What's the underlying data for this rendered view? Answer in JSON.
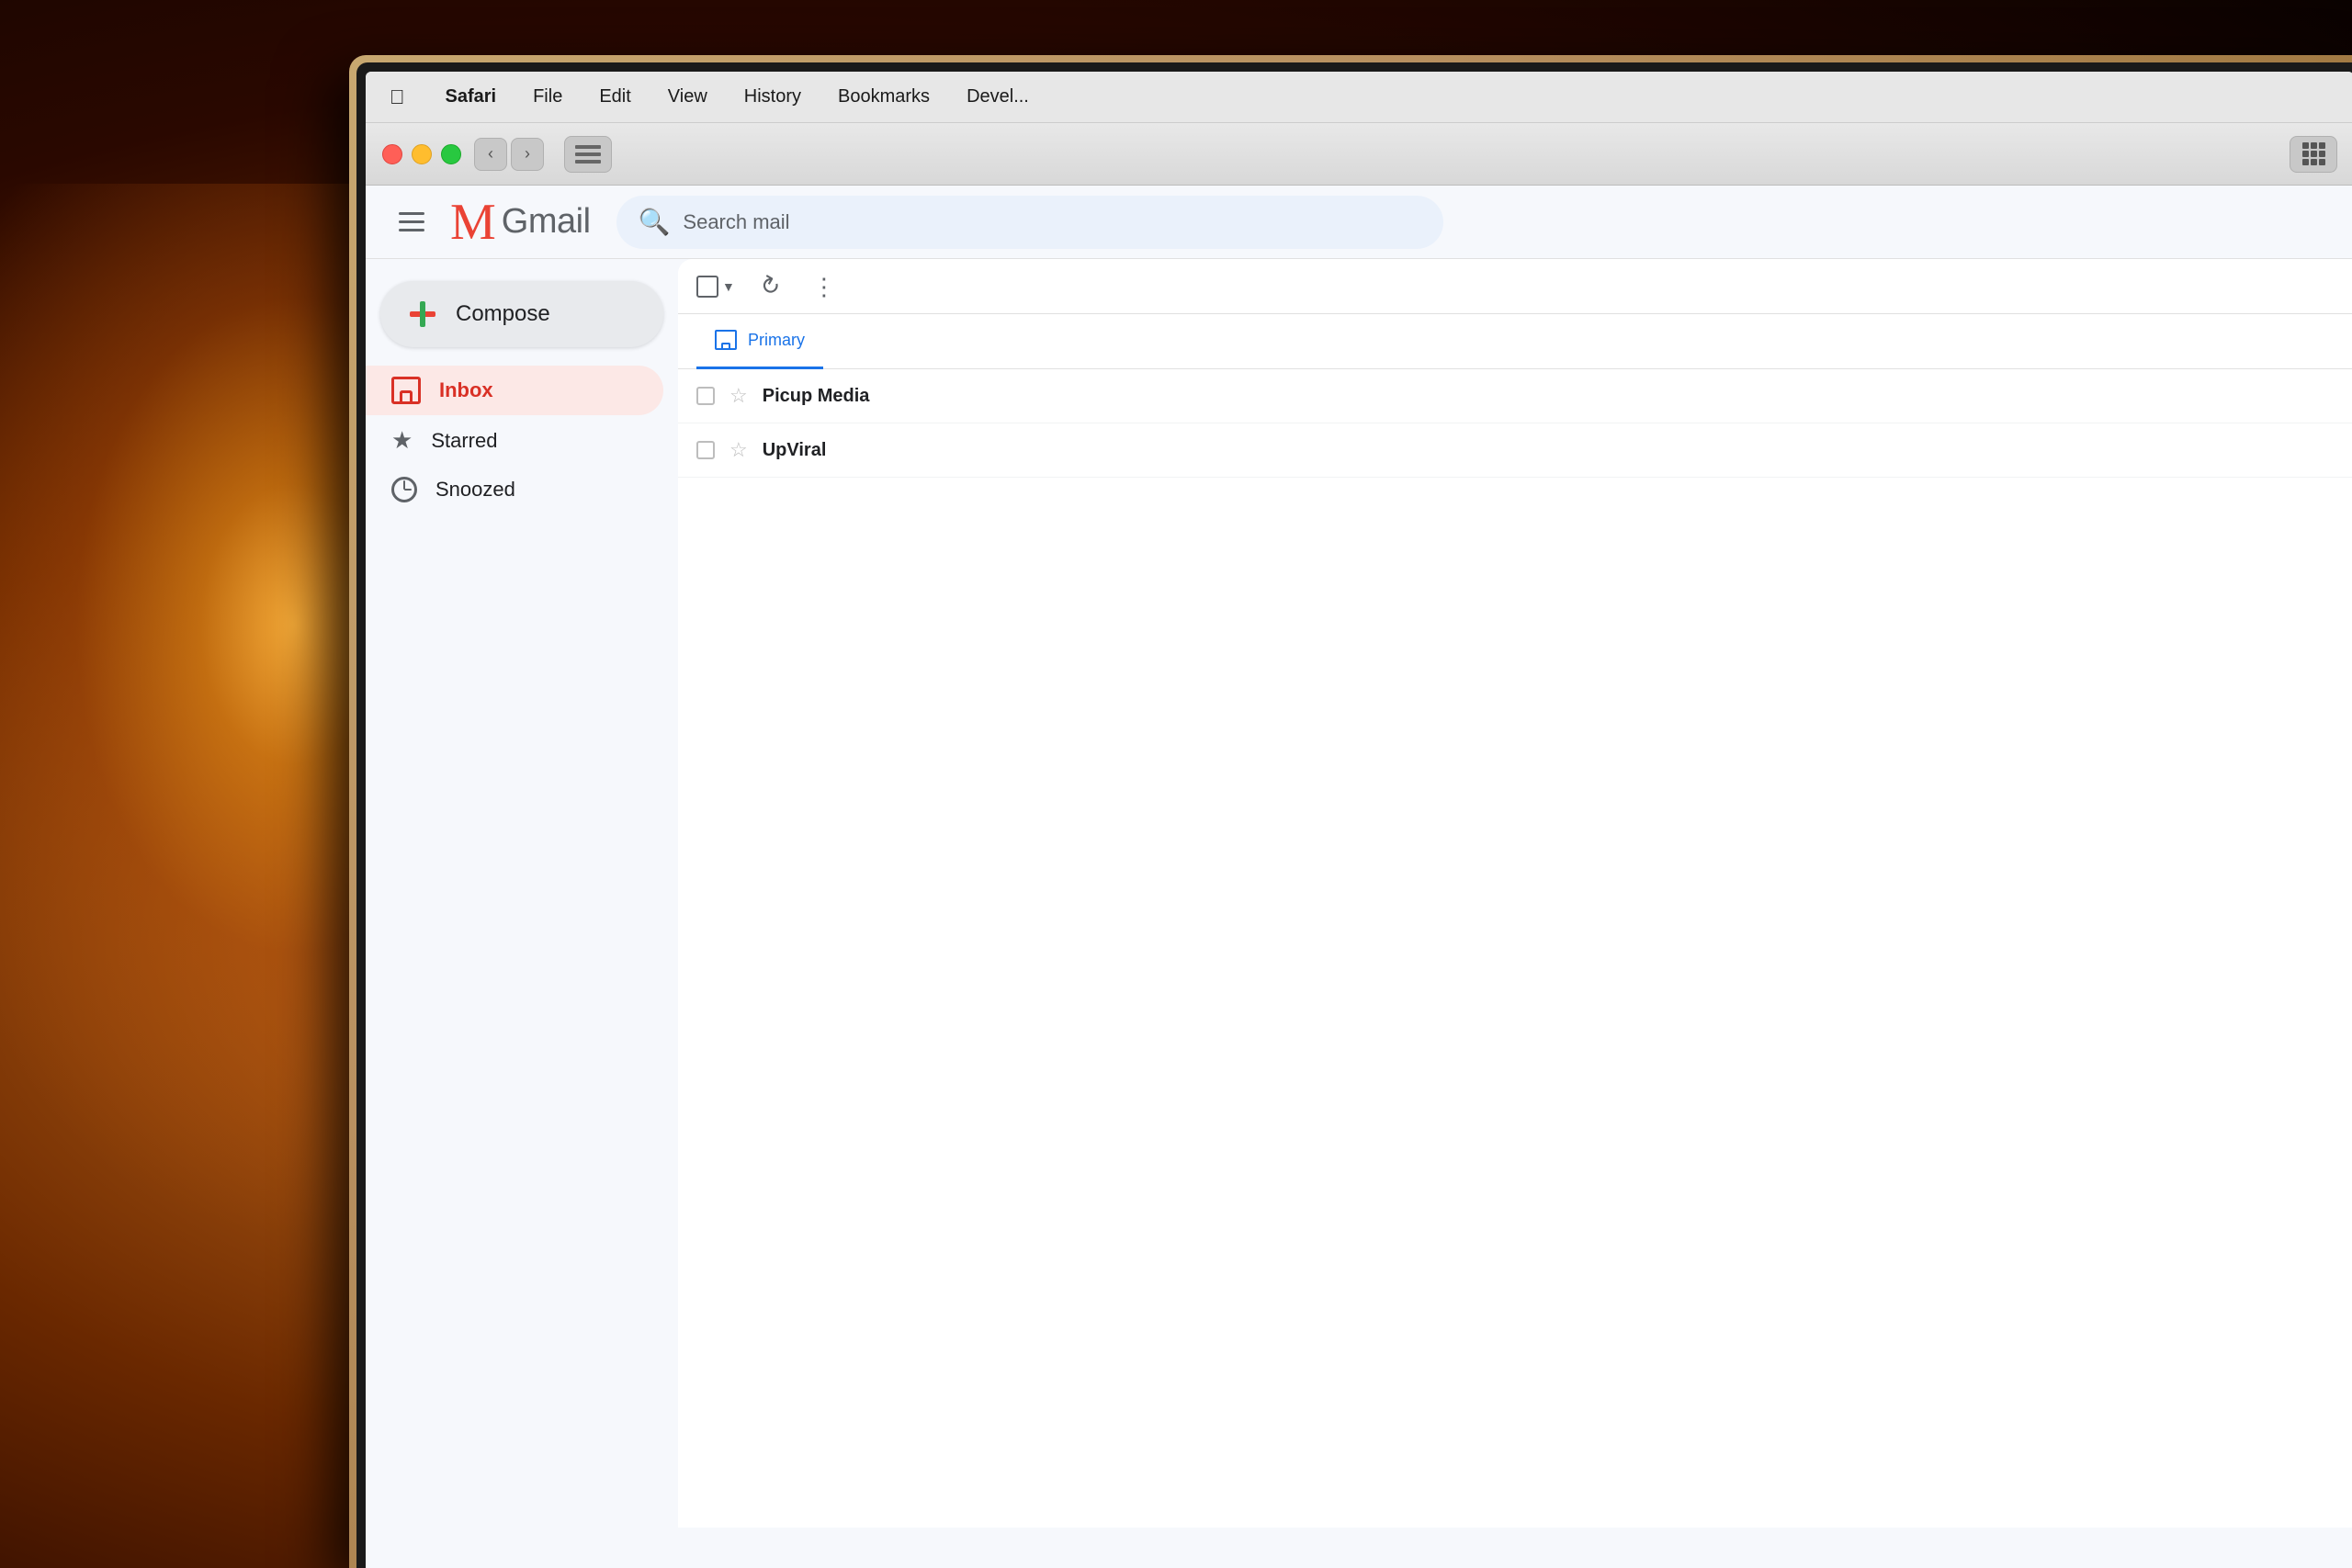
{
  "background": {
    "desc": "warm ambient photo background with lamp glow"
  },
  "macos_menu": {
    "items": [
      {
        "id": "apple",
        "label": ""
      },
      {
        "id": "safari",
        "label": "Safari",
        "bold": true
      },
      {
        "id": "file",
        "label": "File"
      },
      {
        "id": "edit",
        "label": "Edit"
      },
      {
        "id": "view",
        "label": "View"
      },
      {
        "id": "history",
        "label": "History"
      },
      {
        "id": "bookmarks",
        "label": "Bookmarks"
      },
      {
        "id": "develop",
        "label": "Devel..."
      }
    ]
  },
  "safari_toolbar": {
    "back_label": "‹",
    "forward_label": "›",
    "sidebar_toggle_label": ""
  },
  "gmail": {
    "logo_m": "M",
    "logo_text": "Gmail",
    "search_placeholder": "Search mail",
    "hamburger_label": "≡",
    "compose_label": "Compose",
    "nav_items": [
      {
        "id": "inbox",
        "label": "Inbox",
        "active": true
      },
      {
        "id": "starred",
        "label": "Starred"
      },
      {
        "id": "snoozed",
        "label": "Snoozed"
      }
    ],
    "tabs": [
      {
        "id": "primary",
        "label": "Primary",
        "active": true
      }
    ],
    "toolbar": {
      "refresh_label": "↺",
      "more_label": "⋮"
    },
    "emails": [
      {
        "id": 1,
        "sender": "Picup Media",
        "starred": false
      },
      {
        "id": 2,
        "sender": "UpViral",
        "starred": false
      }
    ]
  },
  "colors": {
    "gmail_red": "#EA4335",
    "gmail_blue": "#4285F4",
    "gmail_green": "#34A853",
    "gmail_yellow": "#FBBC04",
    "inactive_nav": "#5f6368",
    "active_nav_bg": "#fce8e6",
    "active_nav_text": "#d93025",
    "toolbar_bg": "#e8eaed",
    "compose_bg": "#e8eaed",
    "search_bg": "#eaf1fb"
  }
}
